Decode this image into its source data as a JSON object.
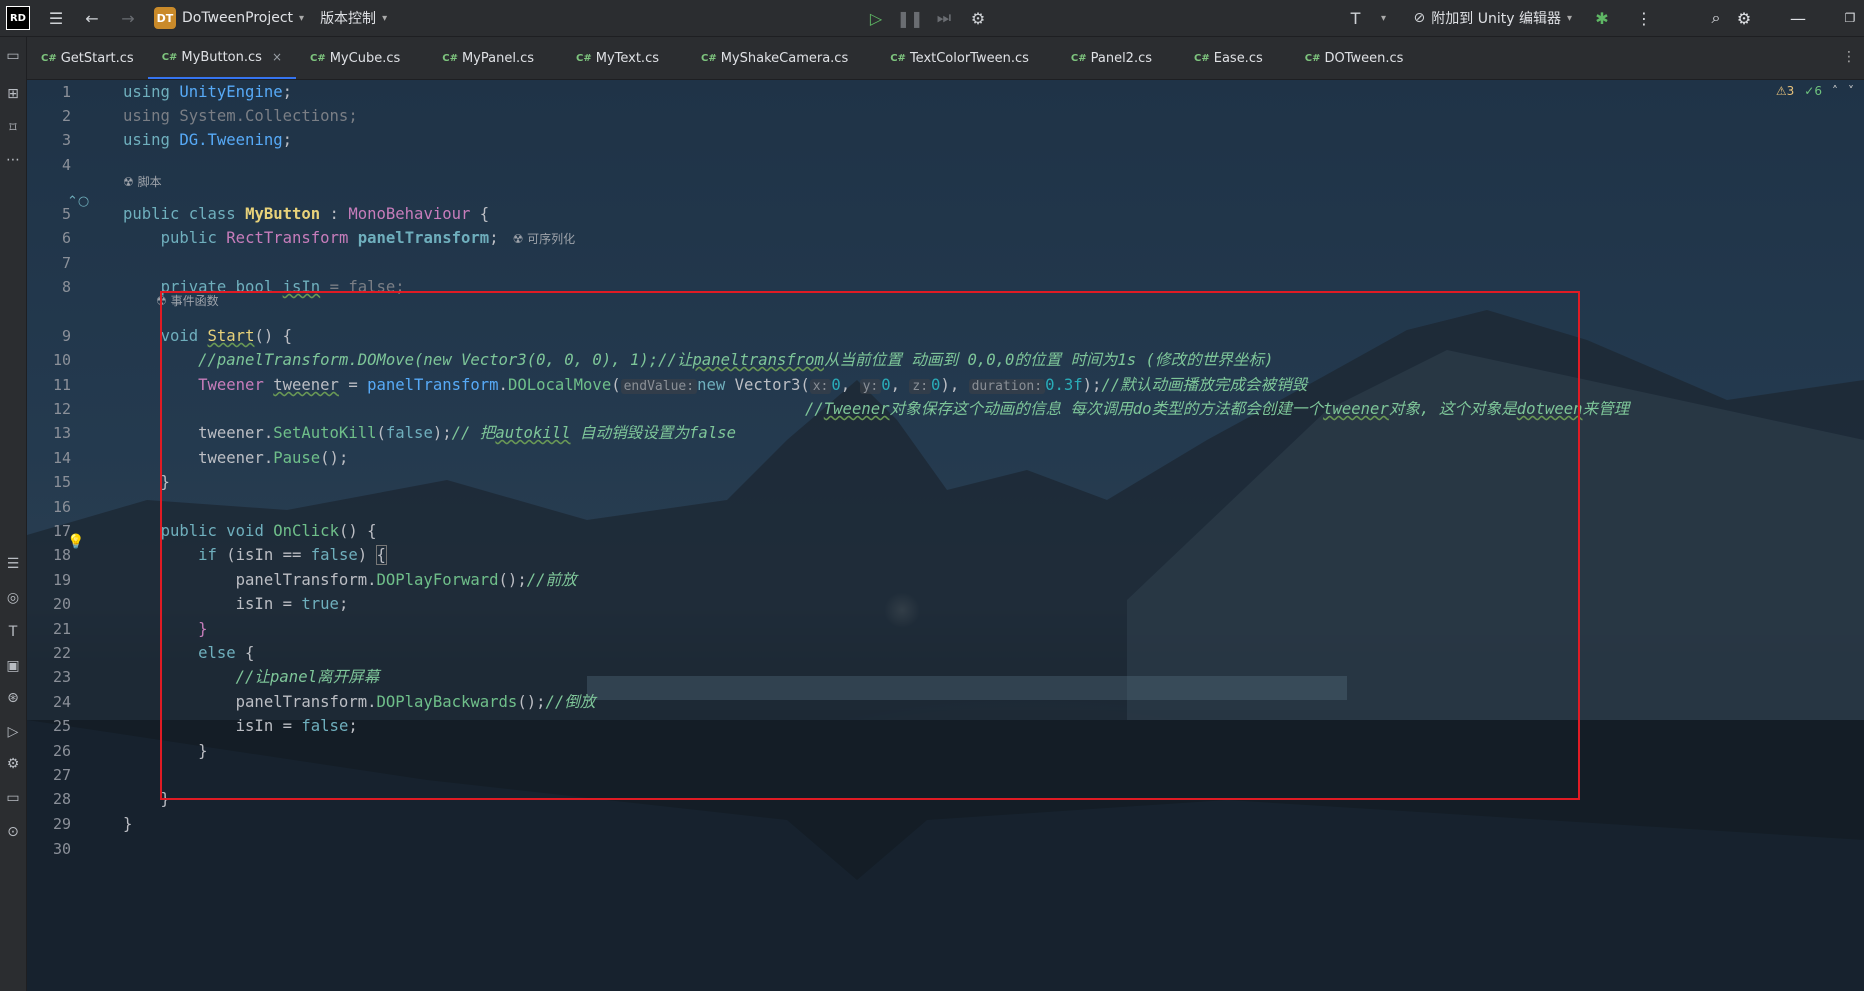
{
  "titlebar": {
    "logo": "RD",
    "project_badge": "DT",
    "project_name": "DoTweenProject",
    "vcs": "版本控制",
    "attach": "附加到 Unity 编辑器"
  },
  "tabs": [
    {
      "label": "GetStart.cs",
      "lang": "C#"
    },
    {
      "label": "MyButton.cs",
      "lang": "C#",
      "active": true
    },
    {
      "label": "MyCube.cs",
      "lang": "C#"
    },
    {
      "label": "MyPanel.cs",
      "lang": "C#"
    },
    {
      "label": "MyText.cs",
      "lang": "C#"
    },
    {
      "label": "MyShakeCamera.cs",
      "lang": "C#"
    },
    {
      "label": "TextColorTween.cs",
      "lang": "C#"
    },
    {
      "label": "Panel2.cs",
      "lang": "C#"
    },
    {
      "label": "Ease.cs",
      "lang": "C#"
    },
    {
      "label": "DOTween.cs",
      "lang": "C#"
    }
  ],
  "editor": {
    "warnings": "3",
    "checks": "6",
    "hint_script": "脚本",
    "hint_serializable": "可序列化",
    "hint_event": "事件函数",
    "line_numbers": [
      "1",
      "2",
      "3",
      "4",
      "5",
      "6",
      "7",
      "8",
      "9",
      "10",
      "11",
      "12",
      "13",
      "14",
      "15",
      "16",
      "17",
      "18",
      "19",
      "20",
      "21",
      "22",
      "23",
      "24",
      "25",
      "26",
      "27",
      "28",
      "29",
      "30"
    ]
  },
  "icons": {
    "menu": "hamburger-icon",
    "back": "arrow-left-icon",
    "forward": "arrow-right-icon",
    "run": "play-icon",
    "debug": "bug-icon",
    "search": "search-icon",
    "settings": "gear-icon"
  },
  "colors": {
    "accent": "#3574f0",
    "selection_box": "#e01b24"
  }
}
